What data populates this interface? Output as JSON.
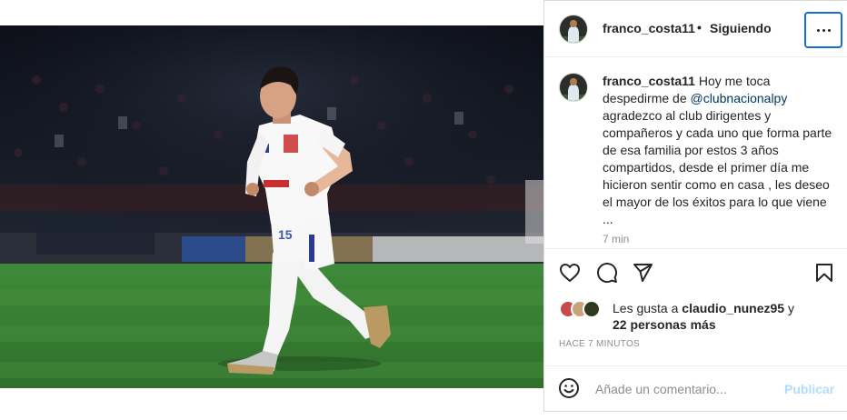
{
  "post": {
    "username": "franco_costa11",
    "separator": "•",
    "follow_status": "Siguiendo",
    "more_icon": "more-horizontal-icon"
  },
  "caption": {
    "username": "franco_costa11",
    "text_1": " Hoy me toca despedirme de ",
    "mention": "@clubnacionalpy",
    "text_2": " agradezco al club dirigentes y compañeros y cada uno que forma parte de esa familia por estos 3 años compartidos, desde el primer día me hicieron sentir como en casa , les deseo el mayor de los éxitos para lo que viene ...",
    "time": "7 min"
  },
  "actions": {
    "like_icon": "heart-icon",
    "comment_icon": "comment-icon",
    "share_icon": "send-icon",
    "save_icon": "bookmark-icon"
  },
  "likes": {
    "prefix": "Les gusta a ",
    "user": "claudio_nunez95",
    "conjunction": " y",
    "others": "22 personas más"
  },
  "time_ago": "HACE 7 MINUTOS",
  "comment": {
    "placeholder": "Añade un comentario...",
    "publish_label": "Publicar",
    "emoji_icon": "emoji-icon"
  },
  "media": {
    "jersey_number": "15"
  },
  "colors": {
    "accent_blue": "#0095f6",
    "publish_disabled": "#b3dbff",
    "focus_ring": "#1a6dd6",
    "mention": "#00376b",
    "muted": "#8e8e8e"
  }
}
